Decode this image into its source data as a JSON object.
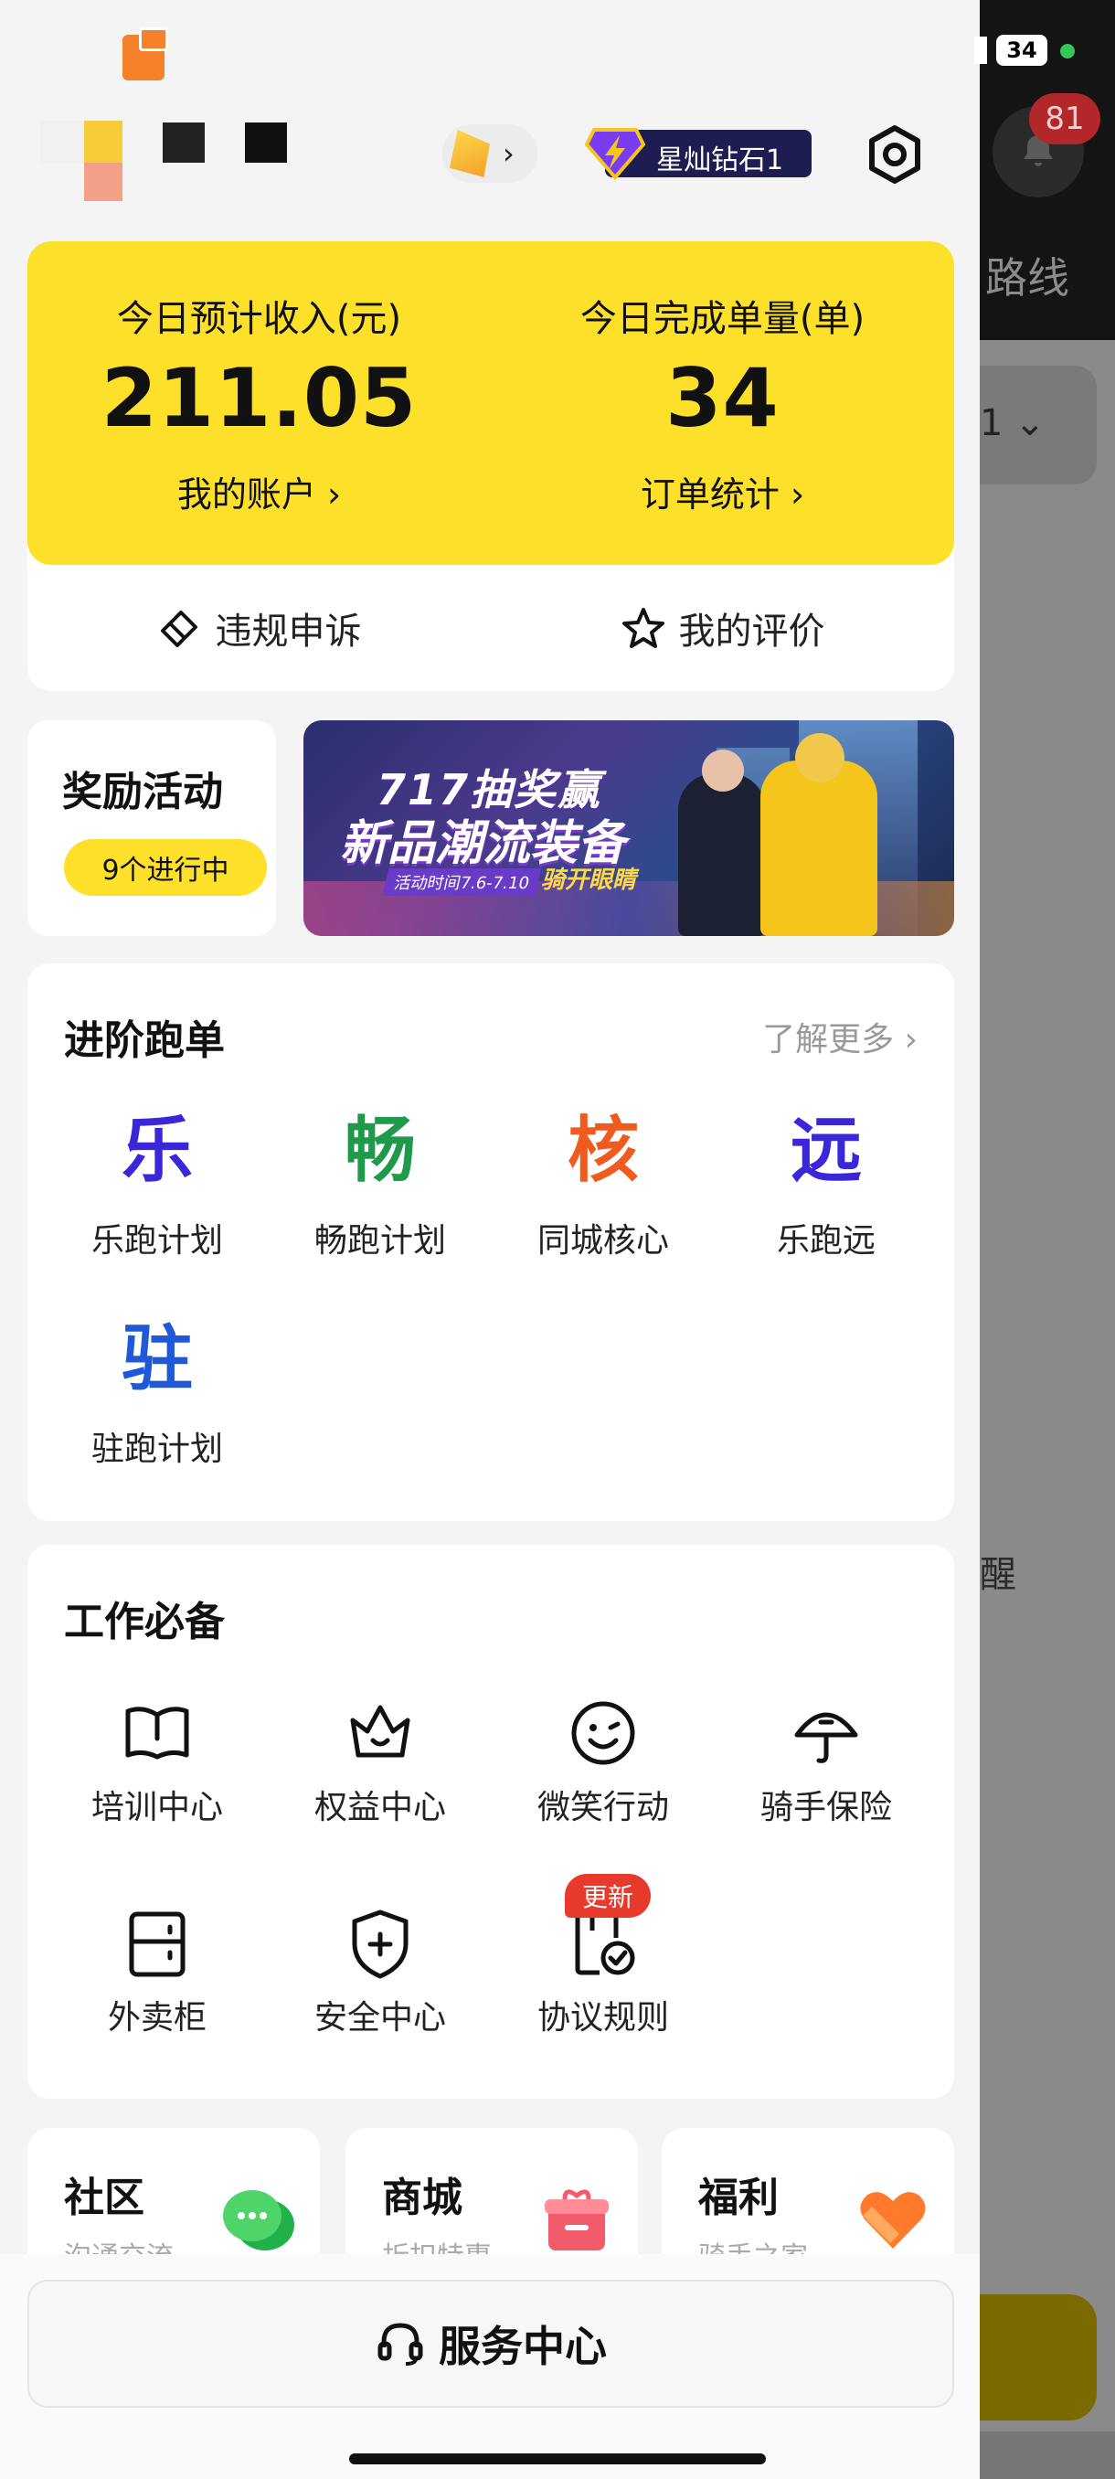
{
  "background_app": {
    "notification_count": "81",
    "route_tab": "路线",
    "card_text": "1 ⌄",
    "reminder_text": "醒"
  },
  "status_bar": {
    "battery": "34"
  },
  "header": {
    "rank_badge": "星灿钻石1"
  },
  "income": {
    "income_label": "今日预计收入(元)",
    "income_value": "211.05",
    "account_link": "我的账户 ›",
    "orders_label": "今日完成单量(单)",
    "orders_value": "34",
    "orders_link": "订单统计 ›",
    "appeal_label": "违规申诉",
    "rating_label": "我的评价"
  },
  "rewards": {
    "title": "奖励活动",
    "ongoing": "9个进行中",
    "banner_line1": "717抽奖赢",
    "banner_line2": "新品潮流装备",
    "banner_date": "活动时间7.6-7.10",
    "banner_cta": "骑开眼睛"
  },
  "advanced": {
    "title": "进阶跑单",
    "more": "了解更多 ›",
    "items": [
      {
        "char": "乐",
        "label": "乐跑计划",
        "color": "#3b27d9"
      },
      {
        "char": "畅",
        "label": "畅跑计划",
        "color": "#1e9a4a"
      },
      {
        "char": "核",
        "label": "同城核心",
        "color": "#ef5a1e"
      },
      {
        "char": "远",
        "label": "乐跑远",
        "color": "#3b27d9"
      },
      {
        "char": "驻",
        "label": "驻跑计划",
        "color": "#1f58d8"
      }
    ]
  },
  "essentials": {
    "title": "工作必备",
    "items": [
      {
        "label": "培训中心",
        "icon": "book-icon"
      },
      {
        "label": "权益中心",
        "icon": "crown-icon"
      },
      {
        "label": "微笑行动",
        "icon": "smile-icon"
      },
      {
        "label": "骑手保险",
        "icon": "umbrella-icon"
      },
      {
        "label": "外卖柜",
        "icon": "locker-icon"
      },
      {
        "label": "安全中心",
        "icon": "shield-icon"
      },
      {
        "label": "协议规则",
        "icon": "agreement-icon"
      }
    ],
    "update_badge": "更新"
  },
  "mini_cards": [
    {
      "title": "社区",
      "subtitle": "沟通交流",
      "icon": "chat-icon"
    },
    {
      "title": "商城",
      "subtitle": "折扣特惠",
      "icon": "gift-icon"
    },
    {
      "title": "福利",
      "subtitle": "骑手之家",
      "icon": "heart-icon"
    }
  ],
  "service": {
    "label": "服务中心"
  }
}
